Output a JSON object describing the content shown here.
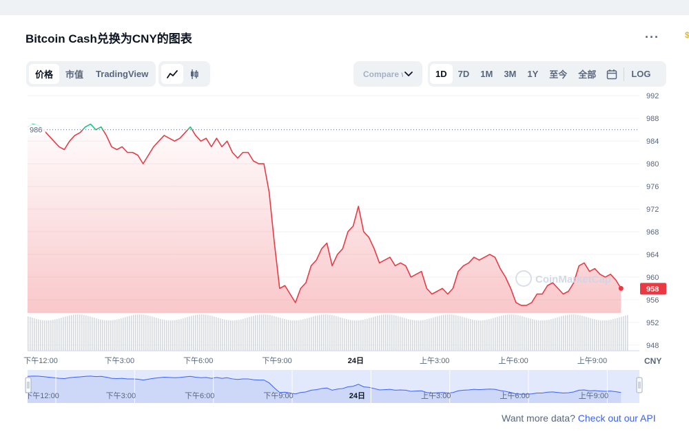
{
  "title": "Bitcoin Cash兑换为CNY的图表",
  "more_icon": "more-horizontal-icon",
  "view_tabs": [
    {
      "label": "价格",
      "active": true
    },
    {
      "label": "市值",
      "active": false
    },
    {
      "label": "TradingView",
      "active": false
    }
  ],
  "chart_type_icons": [
    {
      "icon": "line-chart-icon",
      "active": true
    },
    {
      "icon": "candlestick-icon",
      "active": false
    }
  ],
  "compare": {
    "label": "Compare with",
    "icon": "chevron-down-icon"
  },
  "ranges": [
    {
      "label": "1D",
      "active": true
    },
    {
      "label": "7D",
      "active": false
    },
    {
      "label": "1M",
      "active": false
    },
    {
      "label": "3M",
      "active": false
    },
    {
      "label": "1Y",
      "active": false
    },
    {
      "label": "至今",
      "active": false
    },
    {
      "label": "全部",
      "active": false
    }
  ],
  "calendar_icon": "calendar-icon",
  "log_label": "LOG",
  "chart_data": {
    "type": "line",
    "title": "Bitcoin Cash兑换为CNY的图表",
    "currency_label": "CNY",
    "y_ticks": [
      992,
      988,
      984,
      980,
      976,
      972,
      968,
      964,
      960,
      956,
      952,
      948
    ],
    "ylim": [
      947,
      993
    ],
    "open_price": 986,
    "open_label": "986",
    "current_price": 958,
    "current_label": "958",
    "watermark": "CoinMarketCap",
    "x_labels": [
      {
        "label": "下午12:00",
        "t": 0.5,
        "bold": false
      },
      {
        "label": "下午3:00",
        "t": 3.5,
        "bold": false
      },
      {
        "label": "下午6:00",
        "t": 6.5,
        "bold": false
      },
      {
        "label": "下午9:00",
        "t": 9.5,
        "bold": false
      },
      {
        "label": "24日",
        "t": 12.5,
        "bold": true
      },
      {
        "label": "上午3:00",
        "t": 15.5,
        "bold": false
      },
      {
        "label": "上午6:00",
        "t": 18.5,
        "bold": false
      },
      {
        "label": "上午9:00",
        "t": 21.5,
        "bold": false
      }
    ],
    "navigator_labels": [
      "下午12:00",
      "下午3:00",
      "下午6:00",
      "下午9:00",
      "24日",
      "上午3:00",
      "上午6:00",
      "上午9:00"
    ],
    "price_series": [
      [
        0.0,
        986.5
      ],
      [
        0.2,
        987.0
      ],
      [
        0.4,
        986.8
      ],
      [
        0.6,
        986.0
      ],
      [
        0.8,
        985.0
      ],
      [
        1.0,
        984.0
      ],
      [
        1.2,
        983.0
      ],
      [
        1.4,
        982.5
      ],
      [
        1.6,
        984.0
      ],
      [
        1.8,
        985.0
      ],
      [
        2.0,
        985.5
      ],
      [
        2.2,
        986.5
      ],
      [
        2.4,
        987.0
      ],
      [
        2.6,
        986.0
      ],
      [
        2.8,
        986.5
      ],
      [
        3.0,
        985.0
      ],
      [
        3.2,
        983.0
      ],
      [
        3.4,
        982.5
      ],
      [
        3.6,
        983.0
      ],
      [
        3.8,
        982.0
      ],
      [
        4.0,
        982.0
      ],
      [
        4.2,
        981.5
      ],
      [
        4.4,
        980.0
      ],
      [
        4.6,
        981.5
      ],
      [
        4.8,
        983.0
      ],
      [
        5.0,
        984.0
      ],
      [
        5.2,
        985.0
      ],
      [
        5.4,
        984.5
      ],
      [
        5.6,
        984.0
      ],
      [
        5.8,
        984.5
      ],
      [
        6.0,
        985.5
      ],
      [
        6.2,
        986.5
      ],
      [
        6.4,
        985.0
      ],
      [
        6.6,
        984.0
      ],
      [
        6.8,
        984.5
      ],
      [
        7.0,
        983.0
      ],
      [
        7.2,
        984.5
      ],
      [
        7.4,
        983.0
      ],
      [
        7.6,
        984.0
      ],
      [
        7.8,
        982.0
      ],
      [
        8.0,
        981.0
      ],
      [
        8.2,
        982.0
      ],
      [
        8.4,
        982.0
      ],
      [
        8.6,
        980.5
      ],
      [
        8.8,
        980.0
      ],
      [
        9.0,
        980.0
      ],
      [
        9.2,
        975.0
      ],
      [
        9.4,
        966.0
      ],
      [
        9.6,
        958.0
      ],
      [
        9.8,
        958.5
      ],
      [
        10.0,
        957.0
      ],
      [
        10.2,
        955.5
      ],
      [
        10.4,
        958.0
      ],
      [
        10.6,
        959.0
      ],
      [
        10.8,
        962.0
      ],
      [
        11.0,
        963.0
      ],
      [
        11.2,
        965.0
      ],
      [
        11.4,
        966.0
      ],
      [
        11.6,
        962.0
      ],
      [
        11.8,
        964.0
      ],
      [
        12.0,
        965.0
      ],
      [
        12.2,
        968.0
      ],
      [
        12.4,
        969.0
      ],
      [
        12.6,
        972.5
      ],
      [
        12.8,
        968.0
      ],
      [
        13.0,
        967.0
      ],
      [
        13.2,
        965.0
      ],
      [
        13.4,
        962.5
      ],
      [
        13.6,
        963.0
      ],
      [
        13.8,
        963.5
      ],
      [
        14.0,
        962.0
      ],
      [
        14.2,
        962.5
      ],
      [
        14.4,
        962.0
      ],
      [
        14.6,
        960.0
      ],
      [
        14.8,
        960.5
      ],
      [
        15.0,
        961.0
      ],
      [
        15.2,
        958.0
      ],
      [
        15.4,
        957.0
      ],
      [
        15.6,
        957.5
      ],
      [
        15.8,
        958.0
      ],
      [
        16.0,
        957.0
      ],
      [
        16.2,
        958.0
      ],
      [
        16.4,
        961.0
      ],
      [
        16.6,
        962.0
      ],
      [
        16.8,
        962.5
      ],
      [
        17.0,
        963.5
      ],
      [
        17.2,
        963.0
      ],
      [
        17.4,
        963.5
      ],
      [
        17.6,
        964.0
      ],
      [
        17.8,
        963.5
      ],
      [
        18.0,
        961.5
      ],
      [
        18.2,
        960.0
      ],
      [
        18.4,
        958.0
      ],
      [
        18.6,
        955.5
      ],
      [
        18.8,
        955.0
      ],
      [
        19.0,
        955.0
      ],
      [
        19.2,
        955.5
      ],
      [
        19.4,
        957.0
      ],
      [
        19.6,
        957.0
      ],
      [
        19.8,
        958.5
      ],
      [
        20.0,
        959.0
      ],
      [
        20.2,
        958.0
      ],
      [
        20.4,
        957.0
      ],
      [
        20.6,
        957.5
      ],
      [
        20.8,
        959.0
      ],
      [
        21.0,
        962.0
      ],
      [
        21.2,
        962.5
      ],
      [
        21.4,
        961.0
      ],
      [
        21.6,
        961.5
      ],
      [
        21.8,
        960.5
      ],
      [
        22.0,
        960.0
      ],
      [
        22.2,
        960.5
      ],
      [
        22.4,
        959.5
      ],
      [
        22.6,
        958.0
      ]
    ],
    "x_range": [
      0,
      23.3
    ],
    "volume_level": 0.88
  },
  "api": {
    "prefix": "Want more data?",
    "link": "Check out our API"
  }
}
